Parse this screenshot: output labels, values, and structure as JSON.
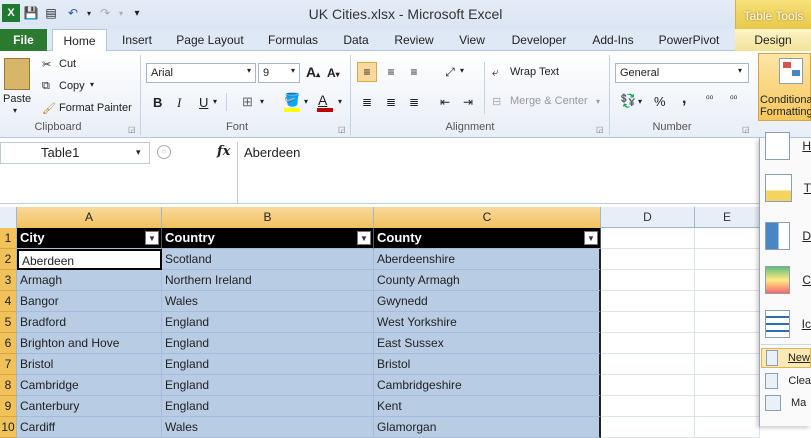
{
  "window": {
    "title": "UK Cities.xlsx - Microsoft Excel",
    "context_tab_group": "Table Tools"
  },
  "tabs": [
    "File",
    "Home",
    "Insert",
    "Page Layout",
    "Formulas",
    "Data",
    "Review",
    "View",
    "Developer",
    "Add-Ins",
    "PowerPivot",
    "Design"
  ],
  "ribbon": {
    "clipboard": {
      "paste": "Paste",
      "cut": "Cut",
      "copy": "Copy",
      "format_painter": "Format Painter",
      "label": "Clipboard"
    },
    "font": {
      "name": "Arial",
      "size": "9",
      "label": "Font",
      "bold": "B",
      "italic": "I",
      "underline": "U",
      "font_color": "A"
    },
    "alignment": {
      "wrap": "Wrap Text",
      "merge": "Merge & Center",
      "label": "Alignment"
    },
    "number": {
      "format": "General",
      "percent": "%",
      "comma": ",",
      "label": "Number"
    },
    "styles": {
      "conditional": "Conditional Formatting"
    }
  },
  "formula_bar": {
    "name_box": "Table1",
    "fx": "fx",
    "value": "Aberdeen"
  },
  "columns": [
    "A",
    "B",
    "C",
    "D",
    "E"
  ],
  "table": {
    "headers": [
      "City",
      "Country",
      "County"
    ],
    "rows": [
      [
        "Aberdeen",
        "Scotland",
        "Aberdeenshire"
      ],
      [
        "Armagh",
        "Northern Ireland",
        "County Armagh"
      ],
      [
        "Bangor",
        "Wales",
        "Gwynedd"
      ],
      [
        "Bradford",
        "England",
        "West Yorkshire"
      ],
      [
        "Brighton and Hove",
        "England",
        "East Sussex"
      ],
      [
        "Bristol",
        "England",
        "Bristol"
      ],
      [
        "Cambridge",
        "England",
        "Cambridgeshire"
      ],
      [
        "Canterbury",
        "England",
        "Kent"
      ],
      [
        "Cardiff",
        "Wales",
        "Glamorgan"
      ]
    ]
  },
  "row_numbers": [
    "1",
    "2",
    "3",
    "4",
    "5",
    "6",
    "7",
    "8",
    "9",
    "10"
  ],
  "menu": {
    "items": [
      "H",
      "T",
      "D",
      "C",
      "Ic"
    ],
    "bottom": [
      "New",
      "Clea",
      "Ma"
    ]
  }
}
